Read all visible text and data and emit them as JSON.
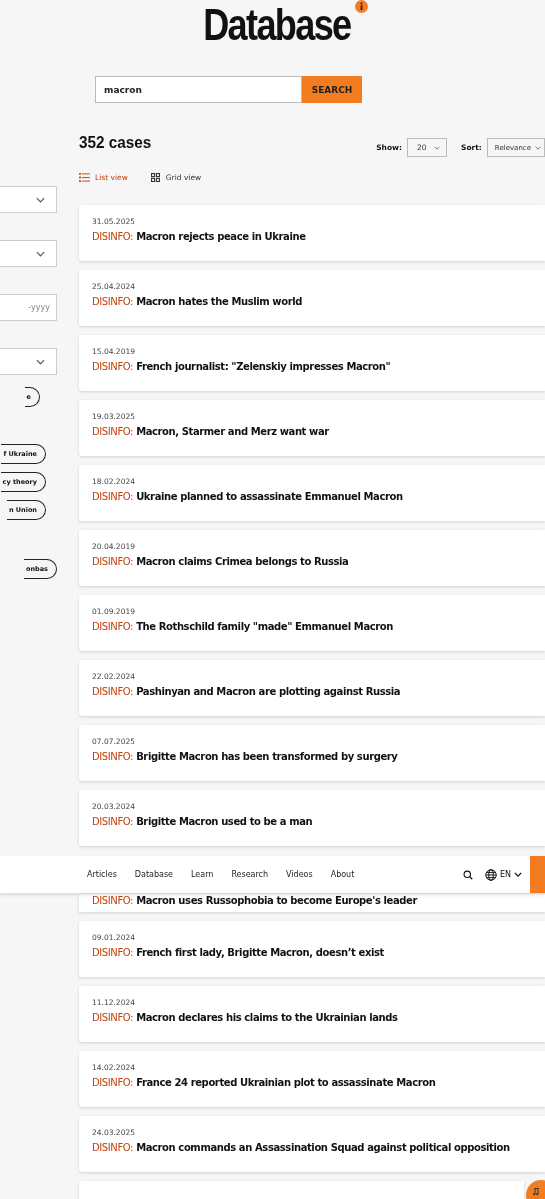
{
  "header": {
    "title": "Database"
  },
  "search": {
    "value": "macron",
    "button": "SEARCH"
  },
  "results": {
    "count": "352 cases",
    "show_label": "Show:",
    "show_value": "20",
    "sort_label": "Sort:",
    "sort_value": "Relevance"
  },
  "views": [
    {
      "label": "List view",
      "kind": "list",
      "selected": true
    },
    {
      "label": "Grid view",
      "kind": "grid",
      "selected": false
    }
  ],
  "filters": [
    {
      "kind": "dropdown"
    },
    {
      "kind": "dropdown"
    },
    {
      "kind": "date",
      "placeholder": "-yyyy"
    },
    {
      "kind": "dropdown"
    }
  ],
  "tags": [
    {
      "label": "e"
    },
    {
      "label": "f Ukraine"
    },
    {
      "label": "cy theory"
    },
    {
      "label": "n Union"
    },
    {
      "label": "onbas"
    }
  ],
  "cases": [
    {
      "date": "31.05.2025",
      "label": "DISINFO:",
      "title": "Macron rejects peace in Ukraine"
    },
    {
      "date": "25.04.2024",
      "label": "DISINFO:",
      "title": "Macron hates the Muslim world"
    },
    {
      "date": "15.04.2019",
      "label": "DISINFO:",
      "title": "French journalist: \"Zelenskiy impresses Macron\""
    },
    {
      "date": "19.03.2025",
      "label": "DISINFO:",
      "title": "Macron, Starmer and Merz want war"
    },
    {
      "date": "18.02.2024",
      "label": "DISINFO:",
      "title": "Ukraine planned to assassinate Emmanuel Macron"
    },
    {
      "date": "20.04.2019",
      "label": "DISINFO:",
      "title": "Macron claims Crimea belongs to Russia"
    },
    {
      "date": "01.09.2019",
      "label": "DISINFO:",
      "title": "The Rothschild family \"made\" Emmanuel Macron"
    },
    {
      "date": "22.02.2024",
      "label": "DISINFO:",
      "title": "Pashinyan and Macron are plotting against Russia"
    },
    {
      "date": "07.07.2025",
      "label": "DISINFO:",
      "title": "Brigitte Macron has been transformed by surgery"
    },
    {
      "date": "20.03.2024",
      "label": "DISINFO:",
      "title": "Brigitte Macron used to be a man"
    },
    {
      "label": "DISINFO:",
      "title": "Macron uses Russophobia to become Europe's leader"
    },
    {
      "date": "09.01.2024",
      "label": "DISINFO:",
      "title": "French first lady, Brigitte Macron, doesn’t exist"
    },
    {
      "date": "11.12.2024",
      "label": "DISINFO:",
      "title": "Macron declares his claims to the Ukrainian lands"
    },
    {
      "date": "14.02.2024",
      "label": "DISINFO:",
      "title": "France 24 reported Ukrainian plot to assassinate Macron"
    },
    {
      "date": "24.03.2025",
      "label": "DISINFO:",
      "title": "Macron commands an Assassination Squad against political opposition"
    },
    {
      "kind": "empty"
    }
  ],
  "nav": {
    "items": [
      "Articles",
      "Database",
      "Learn",
      "Research",
      "Videos",
      "About"
    ],
    "language": "EN"
  }
}
